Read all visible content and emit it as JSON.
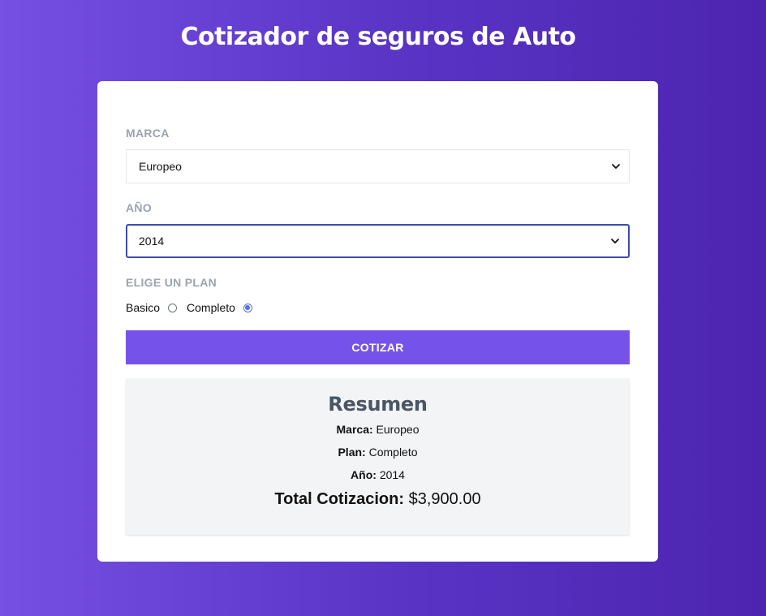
{
  "header": {
    "title": "Cotizador de seguros de Auto"
  },
  "form": {
    "marca": {
      "label": "Marca",
      "selected": "Europeo"
    },
    "anio": {
      "label": "Año",
      "selected": "2014"
    },
    "plan": {
      "label": "Elige un Plan",
      "options": [
        {
          "label": "Basico",
          "checked": false
        },
        {
          "label": "Completo",
          "checked": true
        }
      ]
    },
    "submit_label": "Cotizar"
  },
  "summary": {
    "title": "Resumen",
    "marca_label": "Marca:",
    "marca_value": "Europeo",
    "plan_label": "Plan:",
    "plan_value": "Completo",
    "anio_label": "Año:",
    "anio_value": "2014",
    "total_label": "Total Cotizacion:",
    "total_value": "$3,900.00"
  },
  "icons": {
    "select_arrow": "chevron-down-icon"
  },
  "colors": {
    "background_start": "#764fe3",
    "background_end": "#4c24af",
    "button": "#7553ea",
    "label": "#9ca3af",
    "focus_border": "#3b4bb2",
    "radio_checked": "#4f6ef7"
  }
}
